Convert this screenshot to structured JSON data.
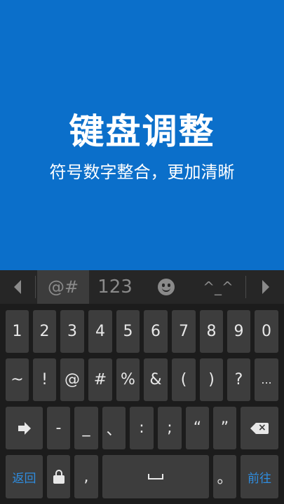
{
  "hero": {
    "title": "键盘调整",
    "subtitle": "符号数字整合，更加清晰"
  },
  "topbar": {
    "left_icon": "triangle-left-icon",
    "tabs": [
      "@#",
      "123",
      "^_^"
    ],
    "emoji_icon": "smiley-icon",
    "right_icon": "triangle-right-icon"
  },
  "rows": {
    "row1": [
      "1",
      "2",
      "3",
      "4",
      "5",
      "6",
      "7",
      "8",
      "9",
      "0"
    ],
    "row2": [
      "~",
      "!",
      "@",
      "#",
      "%",
      "&",
      "(",
      ")",
      "?",
      "..."
    ],
    "row3": [
      "-",
      "_",
      "、",
      ":",
      ";",
      "“",
      "”"
    ],
    "row4": {
      "back_label": "返回",
      "comma": ",",
      "period": "。",
      "go_label": "前往"
    }
  },
  "colors": {
    "hero_bg": "#0b6fca",
    "accent": "#2f8de0",
    "key_bg": "#3d3d3d"
  }
}
